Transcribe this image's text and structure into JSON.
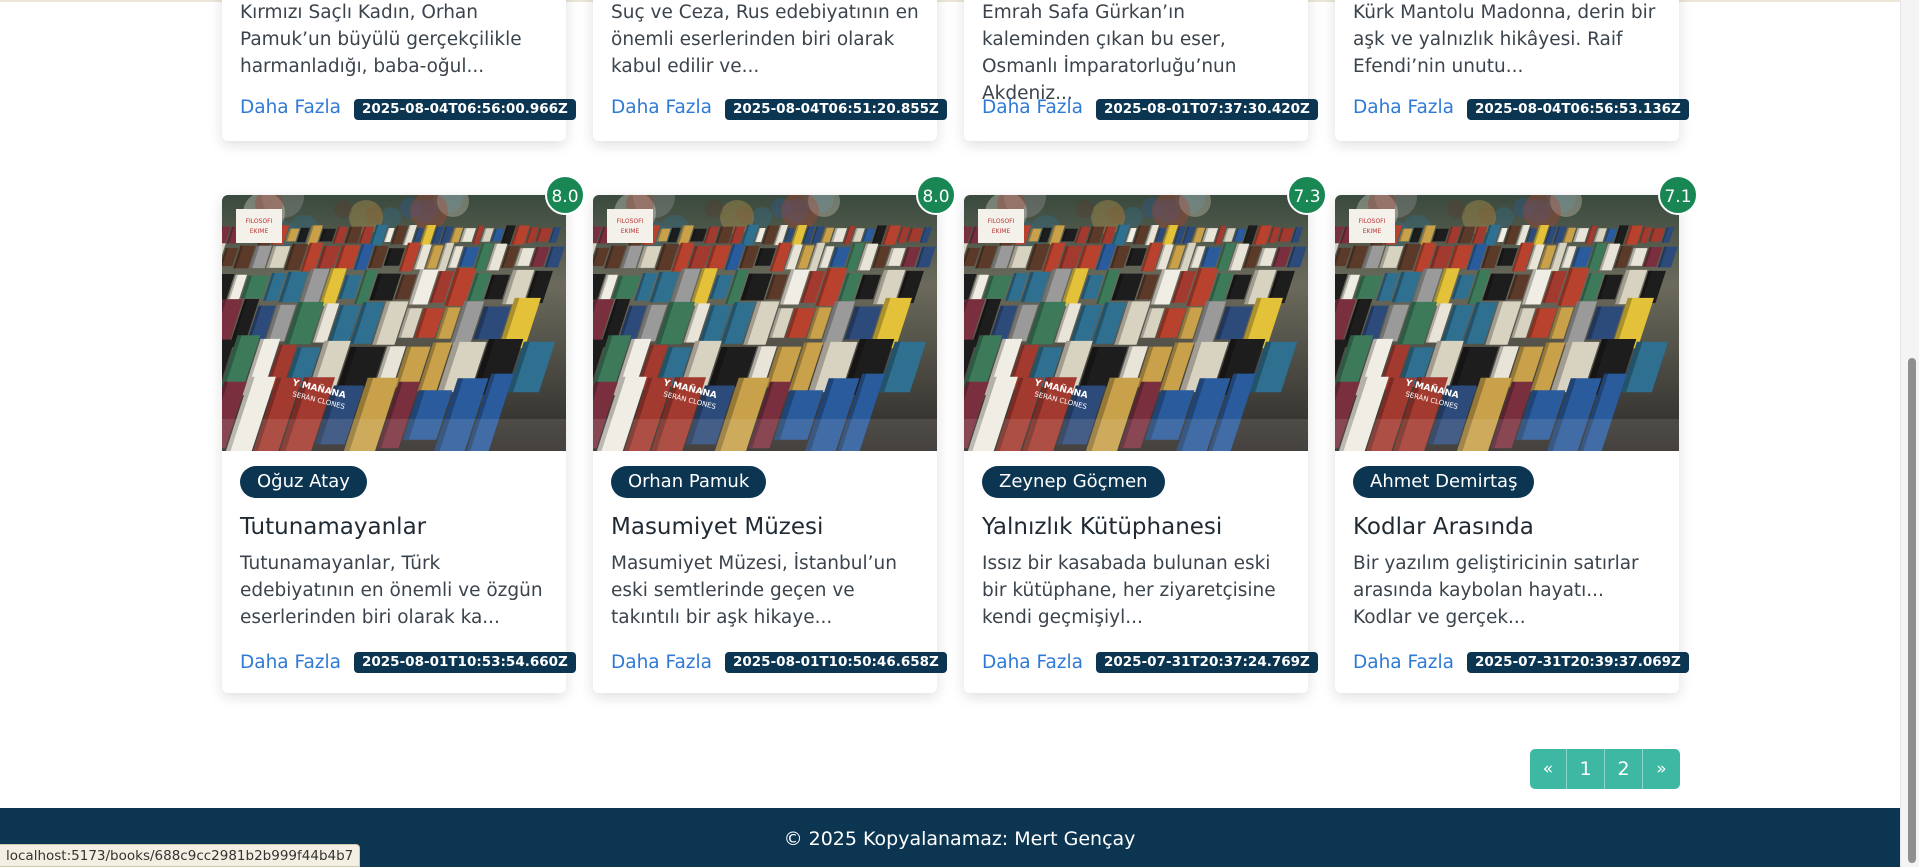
{
  "top_cards": [
    {
      "description": "Kırmızı Saçlı Kadın, Orhan Pamuk’un büyülü gerçekçilikle harmanladığı, baba-oğul...",
      "link_label": "Daha Fazla",
      "date": "2025-08-04T06:56:00.966Z"
    },
    {
      "description": "Suç ve Ceza, Rus edebiyatının en önemli eserlerinden biri olarak kabul edilir ve...",
      "link_label": "Daha Fazla",
      "date": "2025-08-04T06:51:20.855Z"
    },
    {
      "description": "Emrah Safa Gürkan’ın kaleminden çıkan bu eser, Osmanlı İmparatorluğu’nun Akdeniz...",
      "link_label": "Daha Fazla",
      "date": "2025-08-01T07:37:30.420Z"
    },
    {
      "description": "Kürk Mantolu Madonna, derin bir aşk ve yalnızlık hikâyesi. Raif Efendi’nin unutu...",
      "link_label": "Daha Fazla",
      "date": "2025-08-04T06:56:53.136Z"
    }
  ],
  "books": [
    {
      "rating": "8.0",
      "author": "Oğuz Atay",
      "title": "Tutunamayanlar",
      "description": "Tutunamayanlar, Türk edebiyatının en önemli ve özgün eserlerinden biri olarak ka...",
      "link_label": "Daha Fazla",
      "date": "2025-08-01T10:53:54.660Z"
    },
    {
      "rating": "8.0",
      "author": "Orhan Pamuk",
      "title": "Masumiyet Müzesi",
      "description": "Masumiyet Müzesi, İstanbul’un eski semtlerinde geçen ve takıntılı bir aşk hikaye...",
      "link_label": "Daha Fazla",
      "date": "2025-08-01T10:50:46.658Z"
    },
    {
      "rating": "7.3",
      "author": "Zeynep Göçmen",
      "title": "Yalnızlık Kütüphanesi",
      "description": "Issız bir kasabada bulunan eski bir kütüphane, her ziyaretçisine kendi geçmişiyl...",
      "link_label": "Daha Fazla",
      "date": "2025-07-31T20:37:24.769Z"
    },
    {
      "rating": "7.1",
      "author": "Ahmet Demirtaş",
      "title": "Kodlar Arasında",
      "description": "Bir yazılım geliştiricinin satırlar arasında kaybolan hayatı... Kodlar ve gerçek...",
      "link_label": "Daha Fazla",
      "date": "2025-07-31T20:39:37.069Z"
    }
  ],
  "cover": {
    "sign_text_1": "FILOSOFI",
    "sign_text_2": "EKIME",
    "spine_text_1": "Y MAÑANA",
    "spine_text_2": "SERÁN CLONES"
  },
  "pagination": {
    "prev": "«",
    "page_1": "1",
    "page_2": "2",
    "next": "»"
  },
  "footer": {
    "text": "© 2025 Kopyalanamaz: Mert Gençay"
  },
  "status_bar": {
    "url": "localhost:5173/books/688c9cc2981b2b999f44b4b7"
  },
  "colors": {
    "rating_badge": "#198754",
    "author_pill": "#0b3550",
    "date_badge": "#0b3550",
    "link": "#2f7ad6",
    "pagination": "#3fb8a3",
    "footer": "#0b3550"
  }
}
